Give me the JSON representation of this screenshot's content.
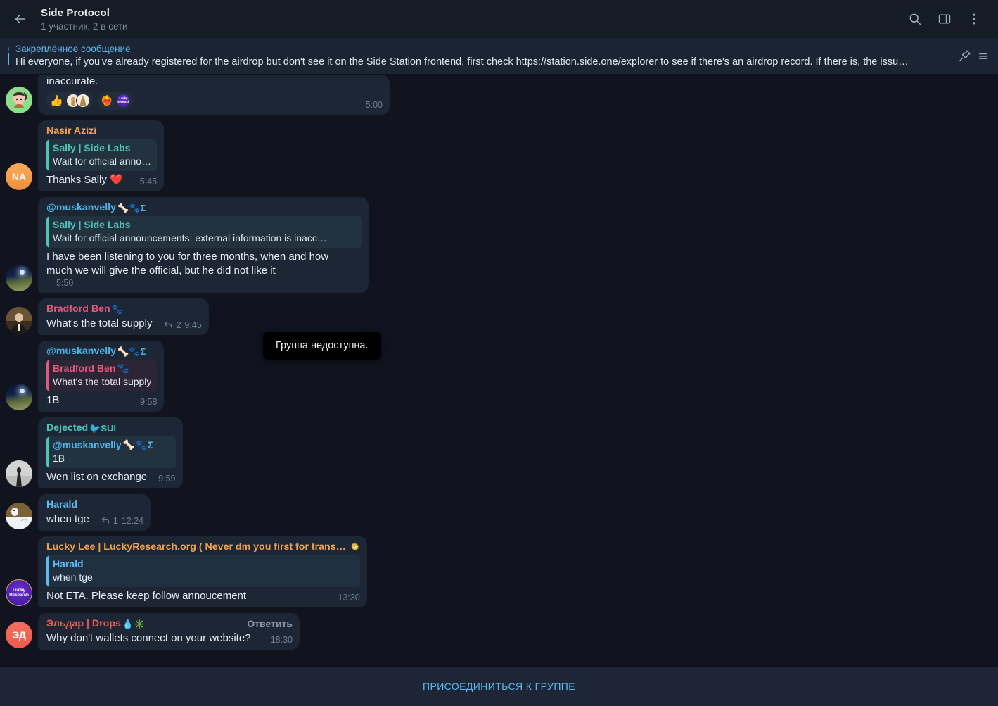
{
  "header": {
    "title": "Side Protocol",
    "subtitle": "1 участник, 2 в сети",
    "back_icon": "arrow-left-icon",
    "search_icon": "search-icon",
    "panel_icon": "sidebar-toggle-icon",
    "menu_icon": "more-vertical-icon"
  },
  "pinned": {
    "label": "Закреплённое сообщение",
    "text": "Hi everyone, if you've already registered for the airdrop but don't see it on the Side Station frontend, first check https://station.side.one/explorer to see if there's an airdrop record. If there is, the issu…",
    "pin_icon": "unpin-icon",
    "list_icon": "pinned-list-icon"
  },
  "tooltip": {
    "text": "Группа недоступна."
  },
  "footer": {
    "join_label": "Присоединиться к группе"
  },
  "colors": {
    "accent": "#5bbaf3",
    "bubble": "#1c2634",
    "quote_teal": "#4cc6bd",
    "quote_pink": "#e4577f",
    "background": "#11141f",
    "header": "#151c26"
  },
  "messages": [
    {
      "id": "m1",
      "partial": true,
      "text": "inaccurate.",
      "time": "5:00",
      "avatar": "sally-avatar",
      "reactions": [
        {
          "glyph": "👍",
          "faces": 2
        },
        {
          "glyph": "❤️‍🔥",
          "faces": 1
        }
      ]
    },
    {
      "id": "m2",
      "sender": "Nasir Azizi",
      "sender_color": "#f0a14e",
      "quote_name": "Sally | Side Labs",
      "quote_name_color": "#4cc6bd",
      "quote_text": "Wait for official anno…",
      "text": "Thanks Sally ❤️",
      "time": "5:45",
      "avatar": "NA"
    },
    {
      "id": "m3",
      "sender": "@muskanvelly",
      "sender_emojis": "🦴🐾Σ",
      "sender_color": "#4fb3e8",
      "quote_name": "Sally | Side Labs",
      "quote_name_color": "#4cc6bd",
      "quote_text": "Wait for official announcements; external information is inacc…",
      "text": "I have been listening to you for three months, when and how much we will give the official, but he did not like it",
      "time": "5:50",
      "avatar": "night-road-avatar"
    },
    {
      "id": "m4",
      "sender": "Bradford Ben",
      "sender_emojis": "🐾",
      "sender_color": "#e4577f",
      "text": "What's the total supply",
      "replies": "2",
      "time": "9:45",
      "avatar": "portrait-avatar"
    },
    {
      "id": "m5",
      "sender": "@muskanvelly",
      "sender_emojis": "🦴🐾Σ",
      "sender_color": "#4fb3e8",
      "quote_name": "Bradford Ben",
      "quote_name_emojis": "🐾",
      "quote_name_color": "#e4577f",
      "quote_text": "What's the total supply",
      "quote_style": "pink",
      "text": "1B",
      "time": "9:58",
      "avatar": "night-road-avatar"
    },
    {
      "id": "m6",
      "sender": "Dejected",
      "sender_emojis": "🐦SUI",
      "sender_color": "#4cc6bd",
      "quote_name": "@muskanvelly",
      "quote_name_emojis": "🦴🐾Σ",
      "quote_name_color": "#4fb3e8",
      "quote_text": "1B",
      "text": "Wen list on exchange",
      "time": "9:59",
      "avatar": "silhouette-avatar"
    },
    {
      "id": "m7",
      "sender": "Harald",
      "sender_color": "#5bbaf3",
      "text": "when tge",
      "replies": "1",
      "time": "12:24",
      "avatar": "bird-avatar"
    },
    {
      "id": "m8",
      "sender": "Lucky Lee | LuckyResearch.org ( Never dm you first for trans…",
      "sender_badge": "verified-star-icon",
      "sender_color": "#f0a14e",
      "quote_name": "Harald",
      "quote_name_color": "#5bbaf3",
      "quote_text": "when tge",
      "quote_style": "blue",
      "text": "Not ETA. Please keep follow annoucement",
      "time": "13:30",
      "avatar": "lucky-research-avatar"
    },
    {
      "id": "m9",
      "sender": "Эльдар | Drops",
      "sender_emojis": "💧✳️",
      "sender_color": "#ef5a52",
      "reply_label": "Ответить",
      "text": "Why don't wallets connect on your website?",
      "time": "18:30",
      "avatar": "ЭД"
    }
  ]
}
